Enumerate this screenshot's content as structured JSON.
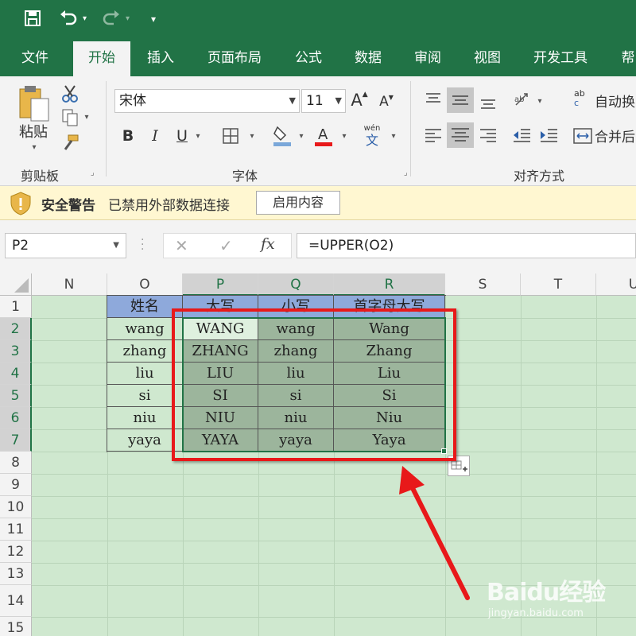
{
  "quick_access": {
    "save_icon": "save-icon",
    "undo_icon": "undo-icon",
    "redo_icon": "redo-icon"
  },
  "tabs": [
    {
      "label": "文件"
    },
    {
      "label": "开始"
    },
    {
      "label": "插入"
    },
    {
      "label": "页面布局"
    },
    {
      "label": "公式"
    },
    {
      "label": "数据"
    },
    {
      "label": "审阅"
    },
    {
      "label": "视图"
    },
    {
      "label": "开发工具"
    },
    {
      "label": "帮"
    }
  ],
  "ribbon": {
    "clipboard": {
      "paste_label": "粘贴",
      "group_label": "剪贴板"
    },
    "font": {
      "font_name": "宋体",
      "font_size": "11",
      "bold": "B",
      "italic": "I",
      "underline": "U",
      "wen_label": "wén",
      "wen_char": "文",
      "group_label": "字体"
    },
    "alignment": {
      "wrap_label": "自动换",
      "merge_label": "合并后",
      "ab_label": "ab",
      "c_label": "c",
      "group_label": "对齐方式"
    }
  },
  "security": {
    "title": "安全警告",
    "message": "已禁用外部数据连接",
    "enable_button": "启用内容"
  },
  "formula_bar": {
    "name_box": "P2",
    "fx": "fx",
    "formula": "=UPPER(O2)"
  },
  "columns": [
    "N",
    "O",
    "P",
    "Q",
    "R",
    "S",
    "T",
    "U"
  ],
  "rows": [
    "1",
    "2",
    "3",
    "4",
    "5",
    "6",
    "7",
    "8",
    "9",
    "10",
    "11",
    "12",
    "13",
    "14",
    "15"
  ],
  "table": {
    "headers": [
      "姓名",
      "大写",
      "小写",
      "首字母大写"
    ],
    "rows": [
      [
        "wang",
        "WANG",
        "wang",
        "Wang"
      ],
      [
        "zhang",
        "ZHANG",
        "zhang",
        "Zhang"
      ],
      [
        "liu",
        "LIU",
        "liu",
        "Liu"
      ],
      [
        "si",
        "SI",
        "si",
        "Si"
      ],
      [
        "niu",
        "NIU",
        "niu",
        "Niu"
      ],
      [
        "yaya",
        "YAYA",
        "yaya",
        "Yaya"
      ]
    ]
  },
  "colors": {
    "excel_green": "#217346",
    "annotation_red": "#e8191a",
    "header_blue": "#8ea9db"
  },
  "watermark": {
    "brand": "Baidu经验",
    "url": "jingyan.baidu.com"
  }
}
